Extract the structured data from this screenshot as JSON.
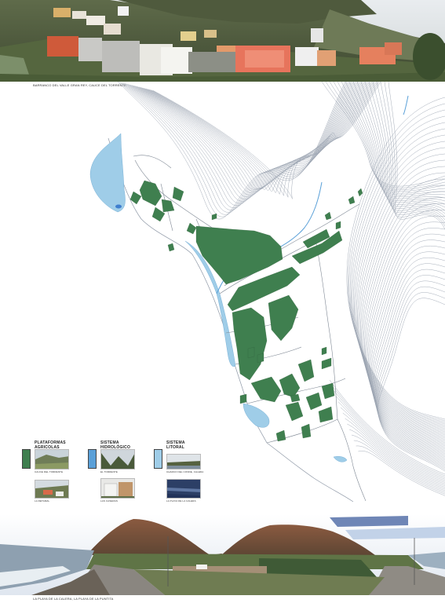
{
  "captions": {
    "top_photo": "BARRANCO DEL VALLE GRAN REY, CAUCE DEL TORRENTE",
    "bottom_photo": "LA PLAYA DE LA CALERA, LA PLAYA DE LA PUNTITA"
  },
  "colors": {
    "agricultural": "#3f7f4f",
    "hydrological": "#5aa0d8",
    "coastal": "#9fcde8",
    "contour": "#9aa3b0"
  },
  "legend": [
    {
      "title": "PLATAFORMAS\nAGRICOLAS",
      "swatch_color": "#3f7f4f",
      "thumbs": [
        {
          "caption": "CAUCE DEL TORRENTE"
        },
        {
          "caption": "LA RETAMAL"
        }
      ]
    },
    {
      "title": "SISTEMA\nHIDROLÓGICO",
      "swatch_color": "#5aa0d8",
      "thumbs": [
        {
          "caption": "EL TORRENTE"
        },
        {
          "caption": "LAS CASERAS"
        }
      ]
    },
    {
      "title": "SISTEMA\nLITORAL",
      "swatch_color": "#9fcde8",
      "thumbs": [
        {
          "caption": "CHARCO DEL CONDE, CALERA"
        },
        {
          "caption": "LA PLAYA DE LA CALERA"
        }
      ]
    }
  ]
}
